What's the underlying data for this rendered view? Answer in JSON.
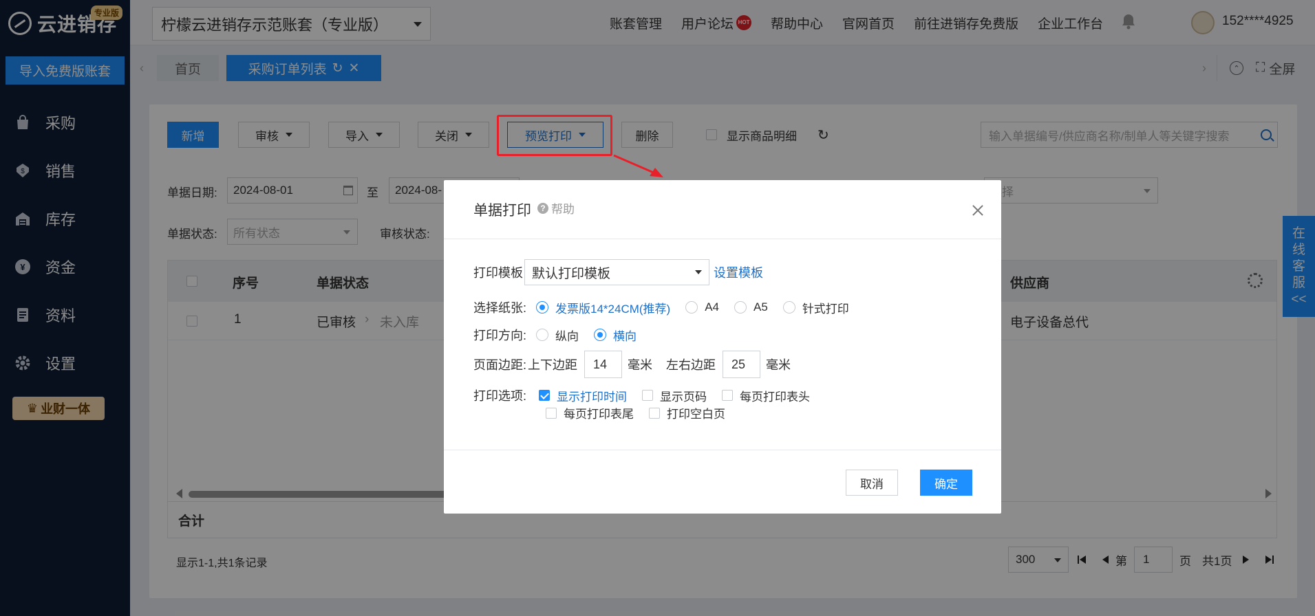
{
  "sidebar": {
    "logo_text": "云进销存",
    "logo_badge": "专业版",
    "import_button": "导入免费版账套",
    "menu": [
      {
        "label": "采购",
        "icon": "bag-icon"
      },
      {
        "label": "销售",
        "icon": "sales-icon"
      },
      {
        "label": "库存",
        "icon": "warehouse-icon"
      },
      {
        "label": "资金",
        "icon": "yen-icon"
      },
      {
        "label": "资料",
        "icon": "document-icon"
      },
      {
        "label": "设置",
        "icon": "gear-icon"
      }
    ],
    "yecai_badge": "业财一体"
  },
  "topbar": {
    "account": "柠檬云进销存示范账套（专业版）",
    "nav": [
      "账套管理",
      "用户论坛",
      "帮助中心",
      "官网首页",
      "前往进销存免费版",
      "企业工作台"
    ],
    "hot_label": "HOT",
    "phone": "152****4925"
  },
  "tabs": {
    "home": "首页",
    "active": "采购订单列表",
    "fullscreen": "全屏"
  },
  "toolbar": {
    "new": "新增",
    "audit": "审核",
    "import": "导入",
    "close": "关闭",
    "preview_print": "预览打印",
    "delete": "删除",
    "show_detail": "显示商品明细",
    "search_placeholder": "输入单据编号/供应商名称/制单人等关键字搜索"
  },
  "filters": {
    "date_label": "单据日期:",
    "date_from": "2024-08-01",
    "to": "至",
    "date_to": "2024-08-",
    "status_label": "单据状态:",
    "status_placeholder": "所有状态",
    "audit_label": "审核状态:",
    "select_placeholder": "选择"
  },
  "table": {
    "headers": {
      "seq": "序号",
      "status": "单据状态",
      "supplier": "供应商"
    },
    "rows": [
      {
        "seq": "1",
        "status": "已审核",
        "sub_status": "未入库",
        "supplier": "电子设备总代"
      }
    ],
    "total_label": "合计"
  },
  "footer": {
    "info": "显示1-1,共1条记录",
    "page_size": "300",
    "page_prefix": "第",
    "page": "1",
    "page_suffix": "页",
    "total_pages": "共1页"
  },
  "online_service": [
    "在",
    "线",
    "客",
    "服",
    "<<"
  ],
  "dialog": {
    "title": "单据打印",
    "help": "帮助",
    "template_label": "打印模板",
    "template_value": "默认打印模板",
    "template_link": "设置模板",
    "paper_label": "选择纸张:",
    "paper_options": [
      {
        "label": "发票版14*24CM(推荐)",
        "selected": true
      },
      {
        "label": "A4",
        "selected": false
      },
      {
        "label": "A5",
        "selected": false
      },
      {
        "label": "针式打印",
        "selected": false
      }
    ],
    "direction_label": "打印方向:",
    "direction_options": [
      {
        "label": "纵向",
        "selected": false
      },
      {
        "label": "横向",
        "selected": true
      }
    ],
    "margin_label": "页面边距:",
    "margin_tb_label": "上下边距",
    "margin_tb": "14",
    "margin_lr_label": "左右边距",
    "margin_lr": "25",
    "unit": "毫米",
    "options_label": "打印选项:",
    "options": [
      {
        "label": "显示打印时间",
        "checked": true
      },
      {
        "label": "显示页码",
        "checked": false
      },
      {
        "label": "每页打印表头",
        "checked": false
      },
      {
        "label": "每页打印表尾",
        "checked": false
      },
      {
        "label": "打印空白页",
        "checked": false
      }
    ],
    "cancel": "取消",
    "ok": "确定"
  },
  "colors": {
    "primary": "#1e90ff",
    "sidebar": "#0f1e36",
    "highlight": "#e8202a"
  }
}
